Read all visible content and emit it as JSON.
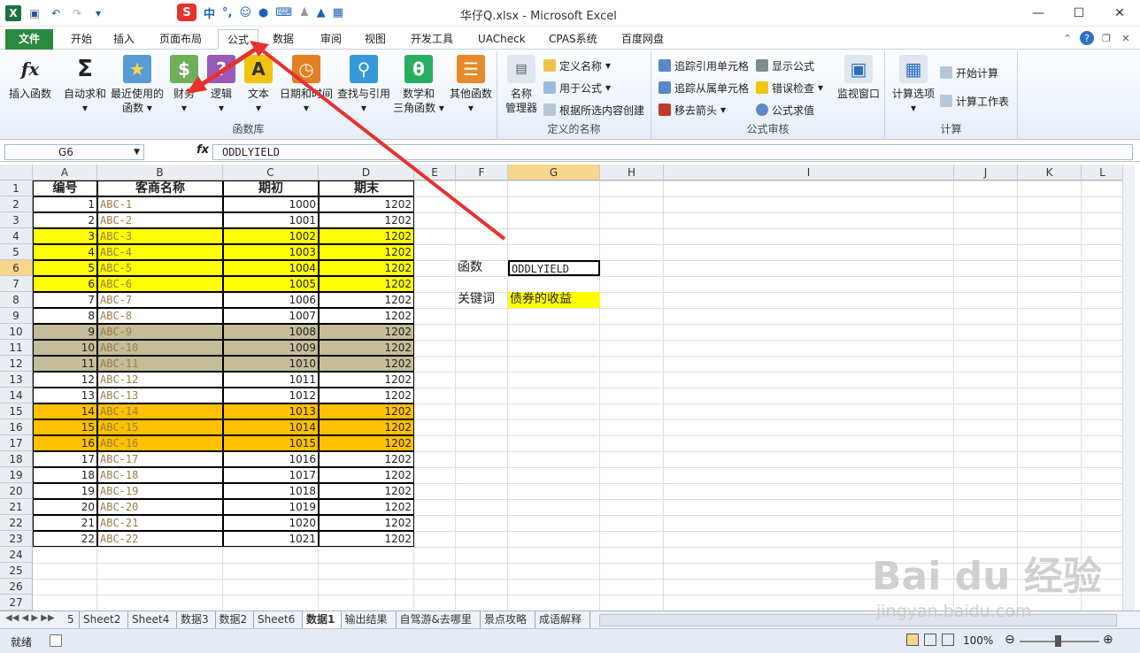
{
  "window": {
    "title": "华仔Q.xlsx - Microsoft Excel"
  },
  "ime": {
    "label1": "中",
    "label2": "°,"
  },
  "tabs": [
    {
      "label": "文件",
      "id": "file"
    },
    {
      "label": "开始",
      "id": "home"
    },
    {
      "label": "插入",
      "id": "insert"
    },
    {
      "label": "页面布局",
      "id": "layout"
    },
    {
      "label": "公式",
      "id": "formulas"
    },
    {
      "label": "数据",
      "id": "data"
    },
    {
      "label": "审阅",
      "id": "review"
    },
    {
      "label": "视图",
      "id": "view"
    },
    {
      "label": "开发工具",
      "id": "dev"
    },
    {
      "label": "UACheck",
      "id": "uacheck"
    },
    {
      "label": "CPAS系统",
      "id": "cpas"
    },
    {
      "label": "百度网盘",
      "id": "baidu"
    }
  ],
  "ribbon": {
    "library": {
      "label": "函数库",
      "insert_fn": "插入函数",
      "autosum": "自动求和",
      "recent1": "最近使用的",
      "recent2": "函数",
      "finance": "财务",
      "logic": "逻辑",
      "text": "文本",
      "datetime": "日期和时间",
      "lookup": "查找与引用",
      "math1": "数学和",
      "math2": "三角函数",
      "other": "其他函数"
    },
    "names": {
      "label": "定义的名称",
      "manager1": "名称",
      "manager2": "管理器",
      "define": "定义名称",
      "use": "用于公式",
      "create": "根据所选内容创建"
    },
    "audit": {
      "label": "公式审核",
      "trace_prec": "追踪引用单元格",
      "trace_dep": "追踪从属单元格",
      "remove": "移去箭头",
      "show": "显示公式",
      "check": "错误检查",
      "eval": "公式求值",
      "watch": "监视窗口"
    },
    "calc": {
      "label": "计算",
      "options": "计算选项",
      "calc_now": "开始计算",
      "calc_sheet": "计算工作表"
    }
  },
  "formula_bar": {
    "name_box": "G6",
    "fx": "fx",
    "formula": "ODDLYIELD"
  },
  "columns": [
    {
      "label": "A",
      "w": 73
    },
    {
      "label": "B",
      "w": 142
    },
    {
      "label": "C",
      "w": 108
    },
    {
      "label": "D",
      "w": 108
    },
    {
      "label": "E",
      "w": 47
    },
    {
      "label": "F",
      "w": 59
    },
    {
      "label": "G",
      "w": 104
    },
    {
      "label": "H",
      "w": 72
    },
    {
      "label": "I",
      "w": 328
    },
    {
      "label": "J",
      "w": 72
    },
    {
      "label": "K",
      "w": 72
    },
    {
      "label": "L",
      "w": 48
    }
  ],
  "headers": [
    "编号",
    "客商名称",
    "期初",
    "期末"
  ],
  "rows": [
    {
      "n": "1",
      "name": "ABC-1",
      "start": "1000",
      "end": "1202",
      "fill": ""
    },
    {
      "n": "2",
      "name": "ABC-2",
      "start": "1001",
      "end": "1202",
      "fill": ""
    },
    {
      "n": "3",
      "name": "ABC-3",
      "start": "1002",
      "end": "1202",
      "fill": "#ffff00"
    },
    {
      "n": "4",
      "name": "ABC-4",
      "start": "1003",
      "end": "1202",
      "fill": "#ffff00"
    },
    {
      "n": "5",
      "name": "ABC-5",
      "start": "1004",
      "end": "1202",
      "fill": "#ffff00"
    },
    {
      "n": "6",
      "name": "ABC-6",
      "start": "1005",
      "end": "1202",
      "fill": "#ffff00"
    },
    {
      "n": "7",
      "name": "ABC-7",
      "start": "1006",
      "end": "1202",
      "fill": ""
    },
    {
      "n": "8",
      "name": "ABC-8",
      "start": "1007",
      "end": "1202",
      "fill": ""
    },
    {
      "n": "9",
      "name": "ABC-9",
      "start": "1008",
      "end": "1202",
      "fill": "#c4bd97"
    },
    {
      "n": "10",
      "name": "ABC-10",
      "start": "1009",
      "end": "1202",
      "fill": "#c4bd97"
    },
    {
      "n": "11",
      "name": "ABC-11",
      "start": "1010",
      "end": "1202",
      "fill": "#c4bd97"
    },
    {
      "n": "12",
      "name": "ABC-12",
      "start": "1011",
      "end": "1202",
      "fill": ""
    },
    {
      "n": "13",
      "name": "ABC-13",
      "start": "1012",
      "end": "1202",
      "fill": ""
    },
    {
      "n": "14",
      "name": "ABC-14",
      "start": "1013",
      "end": "1202",
      "fill": "#ffc000"
    },
    {
      "n": "15",
      "name": "ABC-15",
      "start": "1014",
      "end": "1202",
      "fill": "#ffc000"
    },
    {
      "n": "16",
      "name": "ABC-16",
      "start": "1015",
      "end": "1202",
      "fill": "#ffc000"
    },
    {
      "n": "17",
      "name": "ABC-17",
      "start": "1016",
      "end": "1202",
      "fill": ""
    },
    {
      "n": "18",
      "name": "ABC-18",
      "start": "1017",
      "end": "1202",
      "fill": ""
    },
    {
      "n": "19",
      "name": "ABC-19",
      "start": "1018",
      "end": "1202",
      "fill": ""
    },
    {
      "n": "20",
      "name": "ABC-20",
      "start": "1019",
      "end": "1202",
      "fill": ""
    },
    {
      "n": "21",
      "name": "ABC-21",
      "start": "1020",
      "end": "1202",
      "fill": ""
    },
    {
      "n": "22",
      "name": "ABC-22",
      "start": "1021",
      "end": "1202",
      "fill": ""
    }
  ],
  "side": {
    "label1": "函数",
    "value1": "ODDLYIELD",
    "label2": "关键词",
    "value2": "债券的收益"
  },
  "sheets": [
    "5",
    "Sheet2",
    "Sheet4",
    "数据3",
    "数据2",
    "Sheet6",
    "数据1",
    "输出结果",
    "自驾游&去哪里",
    "景点攻略",
    "成语解释"
  ],
  "active_sheet": "数据1",
  "status": {
    "ready": "就绪",
    "zoom": "100%"
  },
  "watermark": {
    "line1": "Bai du 经验",
    "line2": "jingyan.baidu.com"
  },
  "colors": {
    "name_text": "#9c7c4c",
    "selection": "#f7d78b",
    "arrow": "#e8312f",
    "file_tab": "#2a8a3e"
  }
}
